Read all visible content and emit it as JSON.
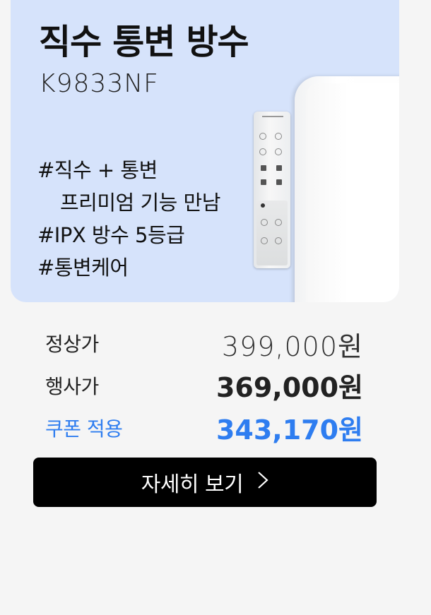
{
  "product": {
    "title": "직수 통변 방수",
    "model": "K9833NF",
    "features": [
      "#직수 + 통변",
      "프리미엄 기능 만남",
      "#IPX 방수 5등급",
      "#통변케어"
    ]
  },
  "pricing": {
    "regular_label": "정상가",
    "regular_value": "399,000원",
    "sale_label": "행사가",
    "sale_value": "369,000원",
    "coupon_label": "쿠폰 적용",
    "coupon_value": "343,170원"
  },
  "cta": {
    "label": "자세히 보기",
    "icon": "chevron-right-icon"
  },
  "colors": {
    "card_bg": "#d6e3fb",
    "accent_blue": "#2e7df0",
    "button_bg": "#000000"
  }
}
